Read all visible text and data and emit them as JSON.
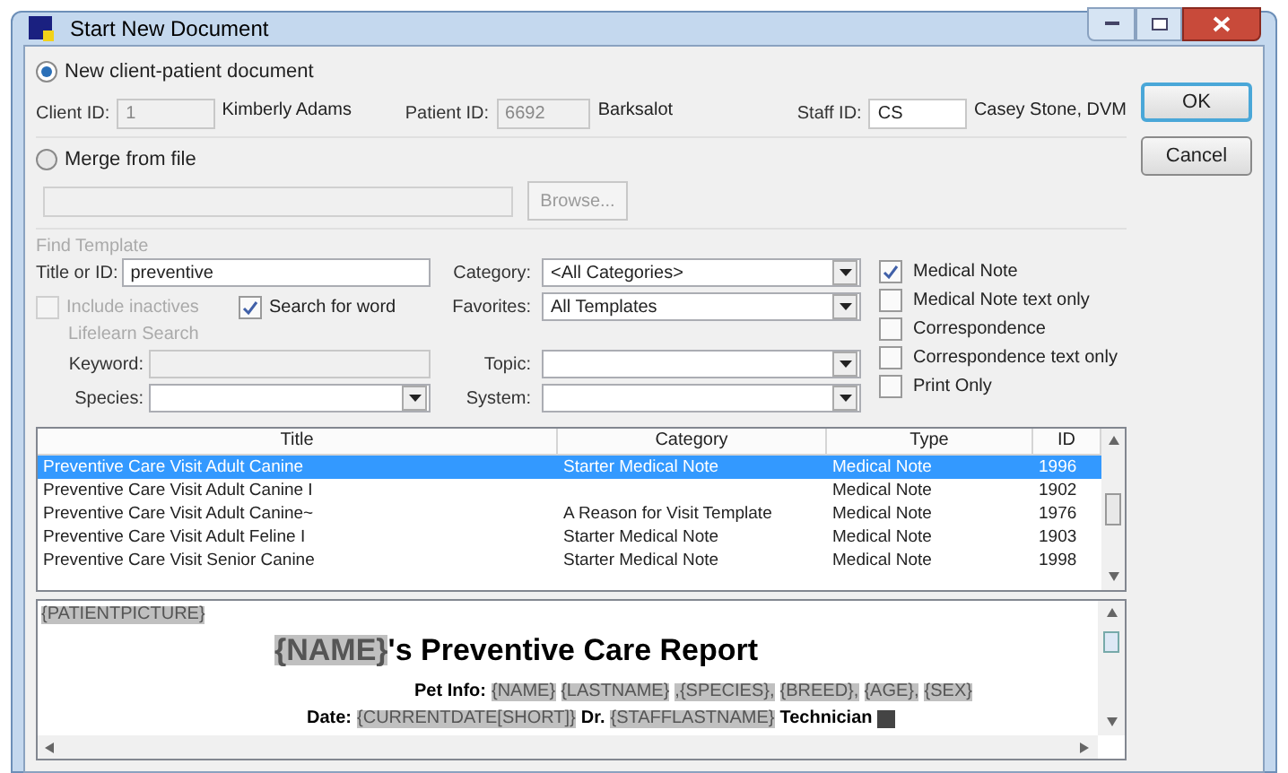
{
  "window": {
    "title": "Start New Document"
  },
  "source_options": [
    {
      "label": "New client-patient document",
      "selected": true
    },
    {
      "label": "Merge from file",
      "selected": false
    }
  ],
  "client": {
    "client_id_label": "Client ID:",
    "client_id": "1",
    "client_name": "Kimberly Adams",
    "patient_id_label": "Patient ID:",
    "patient_id": "6692",
    "patient_name": "Barksalot",
    "staff_id_label": "Staff ID:",
    "staff_id": "CS",
    "staff_name": "Casey Stone, DVM"
  },
  "merge": {
    "browse_button": "Browse..."
  },
  "find_template": {
    "legend": "Find Template",
    "title_label": "Title or ID:",
    "title_value": "preventive",
    "category_label": "Category:",
    "category_value": "<All Categories>",
    "favorites_label": "Favorites:",
    "favorites_value": "All Templates",
    "include_inactives": {
      "label": "Include inactives",
      "checked": false,
      "disabled": true
    },
    "search_for_word": {
      "label": "Search for word",
      "checked": true
    },
    "lifelearn_legend": "Lifelearn Search",
    "keyword_label": "Keyword:",
    "species_label": "Species:",
    "topic_label": "Topic:",
    "system_label": "System:"
  },
  "type_filters": [
    {
      "label": "Medical Note",
      "checked": true
    },
    {
      "label": "Medical Note text only",
      "checked": false
    },
    {
      "label": "Correspondence",
      "checked": false
    },
    {
      "label": "Correspondence text only",
      "checked": false
    },
    {
      "label": "Print Only",
      "checked": false
    }
  ],
  "table": {
    "columns": [
      "Title",
      "Category",
      "Type",
      "ID"
    ],
    "rows": [
      {
        "cells": [
          "Preventive Care Visit Adult Canine",
          "Starter Medical Note",
          "Medical Note",
          "1996"
        ],
        "selected": true
      },
      {
        "cells": [
          "Preventive Care Visit Adult Canine I",
          "",
          "Medical Note",
          "1902"
        ],
        "selected": false
      },
      {
        "cells": [
          "Preventive Care Visit Adult Canine~",
          "A Reason for Visit Template",
          "Medical Note",
          "1976"
        ],
        "selected": false
      },
      {
        "cells": [
          "Preventive Care Visit Adult Feline I",
          "Starter Medical Note",
          "Medical Note",
          "1903"
        ],
        "selected": false
      },
      {
        "cells": [
          "Preventive Care Visit Senior Canine",
          "Starter Medical Note",
          "Medical Note",
          "1998"
        ],
        "selected": false
      }
    ]
  },
  "preview": {
    "lines": [
      {
        "kind": "picture",
        "segments": [
          {
            "kind": "field",
            "text": "{PATIENTPICTURE}"
          }
        ]
      },
      {
        "kind": "heading",
        "segments": [
          {
            "kind": "field",
            "text": "{NAME}"
          },
          {
            "kind": "text",
            "text": "'s Preventive Care Report"
          }
        ]
      },
      {
        "kind": "info",
        "segments": [
          {
            "kind": "text",
            "text": "Pet Info:"
          },
          {
            "kind": "field",
            "text": "{NAME}"
          },
          {
            "kind": "field",
            "text": "{LASTNAME}"
          },
          {
            "kind": "field",
            "text": ",{SPECIES},"
          },
          {
            "kind": "field",
            "text": "{BREED},"
          },
          {
            "kind": "field",
            "text": "{AGE},"
          },
          {
            "kind": "field",
            "text": "{SEX}"
          }
        ]
      },
      {
        "kind": "info",
        "segments": [
          {
            "kind": "text",
            "text": "Date:"
          },
          {
            "kind": "field",
            "text": "{CURRENTDATE[SHORT]}"
          },
          {
            "kind": "text",
            "text": "Dr."
          },
          {
            "kind": "field",
            "text": "{STAFFLASTNAME}"
          },
          {
            "kind": "text",
            "text": "Technician"
          },
          {
            "kind": "block"
          }
        ]
      }
    ]
  },
  "buttons": [
    {
      "label": "OK",
      "default": true
    },
    {
      "label": "Cancel",
      "default": false
    }
  ]
}
